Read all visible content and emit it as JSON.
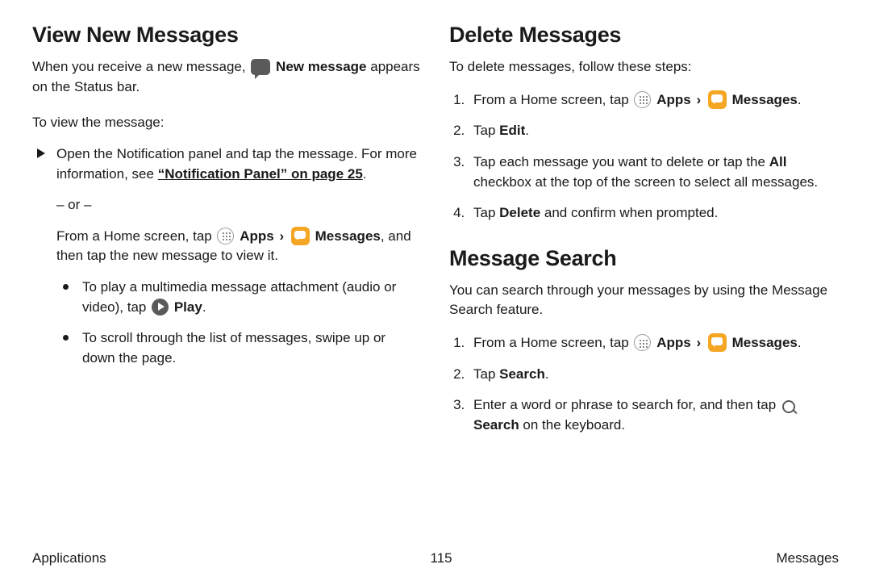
{
  "left": {
    "heading": "View New Messages",
    "intro_a": "When you receive a new message, ",
    "intro_icon_label": "New message",
    "intro_b": " appears on the Status bar.",
    "lead": "To view the message:",
    "tri1_a": "Open the Notification panel and tap the message. For more information, see ",
    "tri1_link": "“Notification Panel” on page 25",
    "tri1_b": ".",
    "or": "– or –",
    "sub_a": "From a Home screen, tap ",
    "apps_label": "Apps",
    "messages_label": "Messages",
    "sub_b": ", and then tap the new message to view it.",
    "dot1_a": "To play a multimedia message attachment (audio or video), tap ",
    "play_label": "Play",
    "dot1_b": ".",
    "dot2": "To scroll through the list of messages, swipe up or down the page."
  },
  "right": {
    "heading1": "Delete Messages",
    "lead1": "To delete messages, follow these steps:",
    "d1_a": "From a Home screen, tap ",
    "apps_label": "Apps",
    "messages_label": "Messages",
    "d1_b": ".",
    "d2_a": "Tap ",
    "d2_bold": "Edit",
    "d2_b": ".",
    "d3_a": "Tap each message you want to delete or tap the ",
    "d3_bold": "All",
    "d3_b": " checkbox at the top of the screen to select all messages.",
    "d4_a": "Tap ",
    "d4_bold": "Delete",
    "d4_b": " and confirm when prompted.",
    "heading2": "Message Search",
    "lead2": "You can search through your messages by using the Message Search feature.",
    "s1_a": "From a Home screen, tap ",
    "s1_b": ".",
    "s2_a": "Tap ",
    "s2_bold": "Search",
    "s2_b": ".",
    "s3_a": "Enter a word or phrase to search for, and then tap ",
    "s3_bold": "Search",
    "s3_b": " on the keyboard."
  },
  "footer": {
    "left": "Applications",
    "center": "115",
    "right": "Messages"
  },
  "glyph": {
    "chev": "›"
  }
}
